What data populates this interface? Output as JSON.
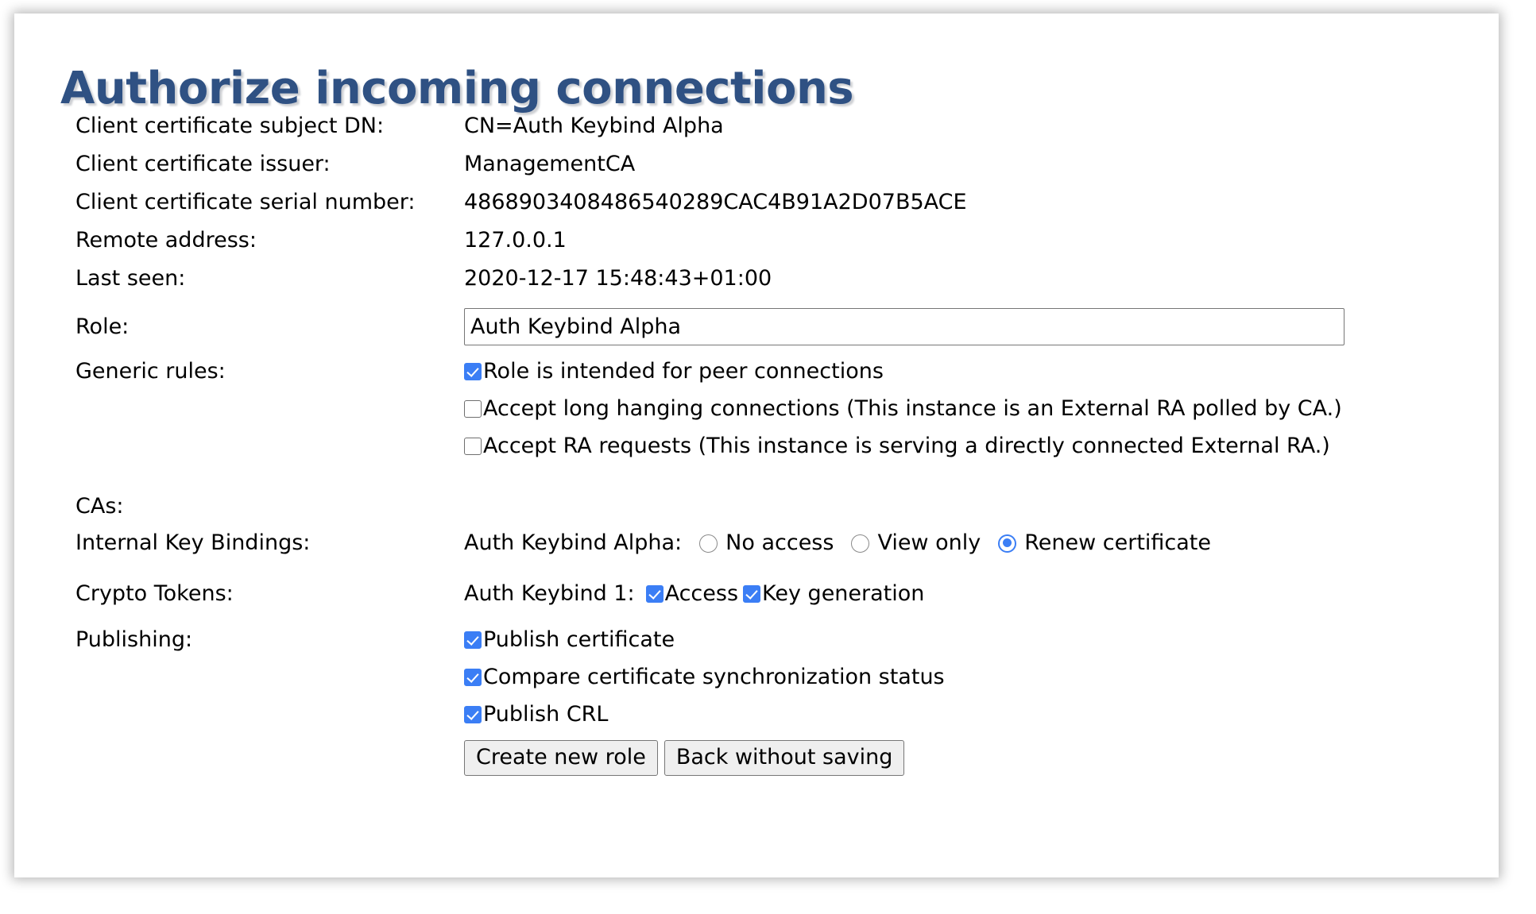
{
  "page": {
    "title": "Authorize incoming connections"
  },
  "info_rows": [
    {
      "label": "Client certificate subject DN:",
      "value": "CN=Auth Keybind Alpha"
    },
    {
      "label": "Client certificate issuer:",
      "value": "ManagementCA"
    },
    {
      "label": "Client certificate serial number:",
      "value": "4868903408486540289CAC4B91A2D07B5ACE"
    },
    {
      "label": "Remote address:",
      "value": "127.0.0.1"
    },
    {
      "label": "Last seen:",
      "value": "2020-12-17 15:48:43+01:00"
    }
  ],
  "role": {
    "label": "Role:",
    "value": "Auth Keybind Alpha"
  },
  "generic_rules": {
    "label": "Generic rules:",
    "items": [
      {
        "label": "Role is intended for peer connections",
        "checked": true
      },
      {
        "label": "Accept long hanging connections (This instance is an External RA polled by CA.)",
        "checked": false
      },
      {
        "label": "Accept RA requests (This instance is serving a directly connected External RA.)",
        "checked": false
      }
    ]
  },
  "cas": {
    "label": "CAs:"
  },
  "internal_key_bindings": {
    "label": "Internal Key Bindings:",
    "entry_name": "Auth Keybind Alpha:",
    "options": [
      {
        "label": "No access",
        "selected": false
      },
      {
        "label": "View only",
        "selected": false
      },
      {
        "label": "Renew certificate",
        "selected": true
      }
    ]
  },
  "crypto_tokens": {
    "label": "Crypto Tokens:",
    "entry_name": "Auth Keybind 1:",
    "options": [
      {
        "label": "Access",
        "checked": true
      },
      {
        "label": "Key generation",
        "checked": true
      }
    ]
  },
  "publishing": {
    "label": "Publishing:",
    "items": [
      {
        "label": "Publish certificate",
        "checked": true
      },
      {
        "label": "Compare certificate synchronization status",
        "checked": true
      },
      {
        "label": "Publish CRL",
        "checked": true
      }
    ]
  },
  "buttons": {
    "submit": "Create new role",
    "back": "Back without saving"
  },
  "colors": {
    "title": "#2f5183",
    "accent": "#3b7ef5",
    "button_face": "#efefef",
    "border": "#767676"
  }
}
